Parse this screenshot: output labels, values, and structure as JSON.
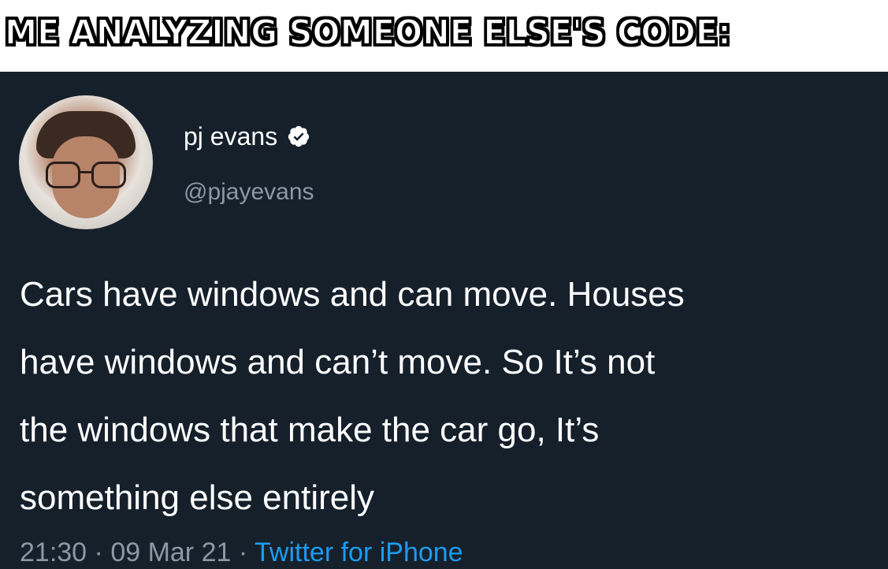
{
  "caption": "ME ANALYZING SOMEONE ELSE'S CODE:",
  "tweet": {
    "display_name": "pj evans",
    "handle": "@pjayevans",
    "verified_icon": "verified-badge-icon",
    "text_lines": [
      "Cars have windows and can move. Houses",
      "have windows and can’t move. So It’s not",
      "the windows that make the car go, It’s",
      "something else entirely"
    ],
    "time": "21:30",
    "separator": " · ",
    "date": "09 Mar 21",
    "source": "Twitter for iPhone"
  },
  "colors": {
    "background": "#15202b",
    "text": "#ffffff",
    "muted": "#8b98a5",
    "link": "#1d9bf0"
  }
}
